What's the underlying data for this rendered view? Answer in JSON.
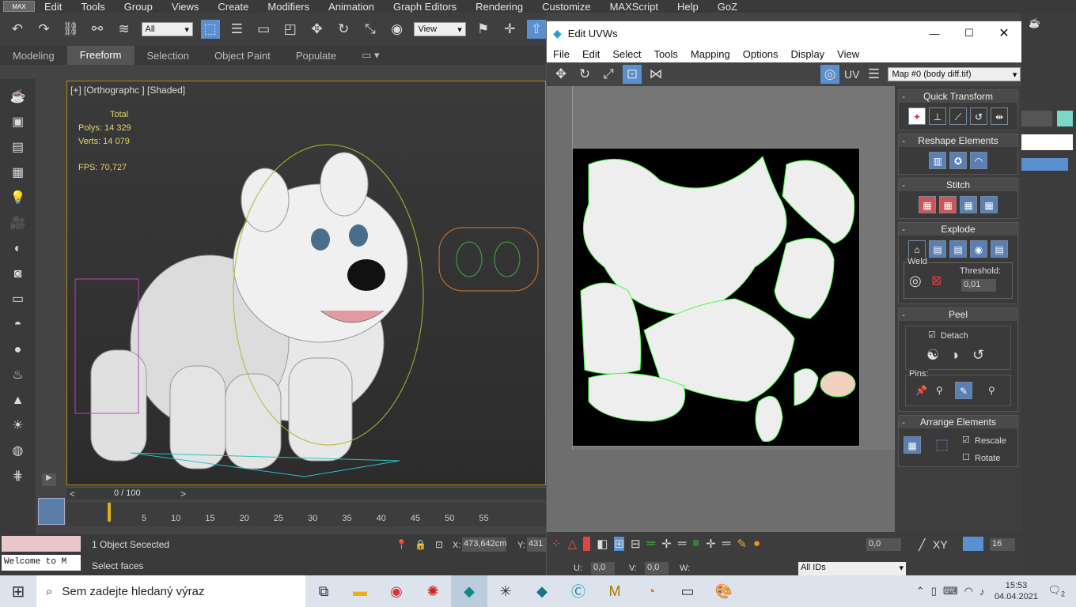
{
  "menubar": {
    "logo": "MAX",
    "items": [
      "Edit",
      "Tools",
      "Group",
      "Views",
      "Create",
      "Modifiers",
      "Animation",
      "Graph Editors",
      "Rendering",
      "Customize",
      "MAXScript",
      "Help",
      "GoZ"
    ]
  },
  "toolbar": {
    "filter_select": "All",
    "view_select": "View"
  },
  "ribbon": {
    "tabs": [
      "Modeling",
      "Freeform",
      "Selection",
      "Object Paint",
      "Populate"
    ],
    "active": "Freeform"
  },
  "viewport": {
    "label": "[+] [Orthographc ] [Shaded]",
    "stats_header": "Total",
    "polys_label": "Polys:",
    "polys_value": "14 329",
    "verts_label": "Verts:",
    "verts_value": "14 079",
    "fps_label": "FPS:",
    "fps_value": "70,727"
  },
  "timeline": {
    "frame": "0 / 100",
    "ticks": [
      "5",
      "10",
      "15",
      "20",
      "25",
      "30",
      "35",
      "40",
      "45",
      "50",
      "55"
    ]
  },
  "status": {
    "selected": "1 Object Secected",
    "prompt": "Select faces",
    "listener": "Welcome to M",
    "x_label": "X:",
    "x_value": "473,642cm",
    "y_label": "Y:",
    "y_value": "431"
  },
  "uvw": {
    "title": "Edit UVWs",
    "menu": [
      "File",
      "Edit",
      "Select",
      "Tools",
      "Mapping",
      "Options",
      "Display",
      "View"
    ],
    "uv_label": "UV",
    "map_select": "Map #0 (body diff.tif)",
    "panel": {
      "quick_transform": "Quick Transform",
      "reshape": "Reshape Elements",
      "stitch": "Stitch",
      "explode": "Explode",
      "weld": "Weld",
      "threshold_label": "Threshold:",
      "threshold_value": "0,01",
      "peel": "Peel",
      "detach": "Detach",
      "pins": "Pins:",
      "arrange": "Arrange Elements",
      "rescale": "Rescale",
      "rotate": "Rotate"
    },
    "bottom": {
      "value_a": "0,0",
      "xy": "XY",
      "grid_value": "16",
      "u_label": "U:",
      "u_value": "0,0",
      "v_label": "V:",
      "v_value": "0,0",
      "w_label": "W:",
      "ids_select": "All IDs"
    }
  },
  "taskbar": {
    "search_placeholder": "Sem zadejte hledaný výraz",
    "time": "15:53",
    "date": "04.04.2021",
    "notifications": "2"
  }
}
